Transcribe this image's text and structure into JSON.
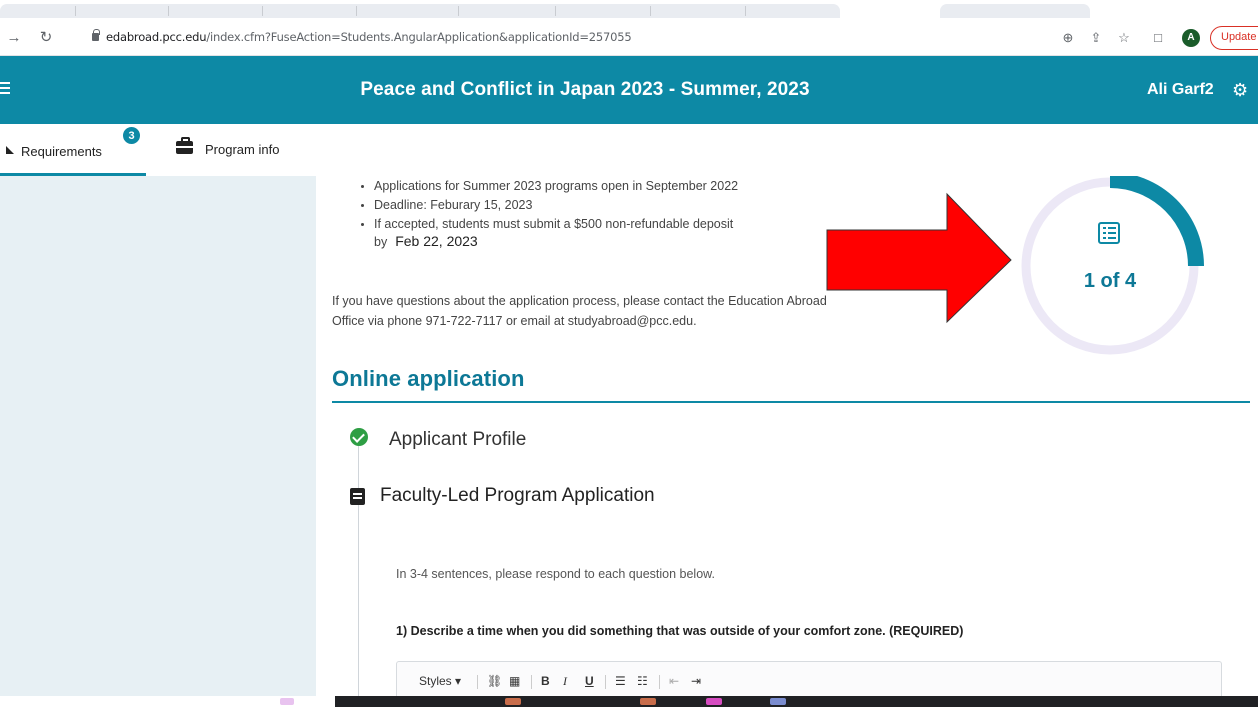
{
  "browser": {
    "url_host": "edabroad.pcc.edu",
    "url_path": "/index.cfm?FuseAction=Students.AngularApplication&applicationId=257055",
    "profile_initial": "A",
    "update_label": "Update"
  },
  "header": {
    "title": "Peace and Conflict in Japan 2023 - Summer, 2023",
    "user_name": "Ali Garf2"
  },
  "tabs": {
    "requirements_label": "Requirements",
    "requirements_badge": "3",
    "program_info_label": "Program info"
  },
  "content": {
    "bullets": [
      "Applications for Summer 2023 programs open in September 2022",
      "Deadline: Feburary 15, 2023",
      "If accepted, students must submit a $500 non-refundable deposit"
    ],
    "by_label": "by",
    "deposit_date": "Feb 22, 2023",
    "contact_text": "If you have questions about the application process, please contact the Education Abroad Office via phone 971-722-7117 or email at studyabroad@pcc.edu.",
    "section_title": "Online application",
    "steps": [
      {
        "label": "Applicant Profile",
        "status": "complete"
      },
      {
        "label": "Faculty-Led Program Application",
        "status": "current"
      }
    ],
    "instructions": "In 3-4 sentences, please respond to each question below.",
    "question_1": "1) Describe a time when you did something that was outside of your comfort zone. (REQUIRED)",
    "editor_styles_label": "Styles"
  },
  "progress": {
    "label": "1 of 4",
    "fraction": 0.25,
    "accent_color": "#0d89a5",
    "track_color": "#ece8f6"
  },
  "annotation": {
    "arrow_color": "#ff0000"
  },
  "icons": {
    "back": "arrow-right-icon",
    "reload": "reload-icon",
    "lock": "lock-icon",
    "zoom": "zoom-icon",
    "share": "share-icon",
    "bookmark": "star-icon",
    "sidepanel": "side-panel-icon",
    "settings": "gear-icon",
    "program": "briefcase-icon",
    "checklist": "list-icon",
    "complete": "check-circle-icon",
    "document": "document-icon"
  }
}
